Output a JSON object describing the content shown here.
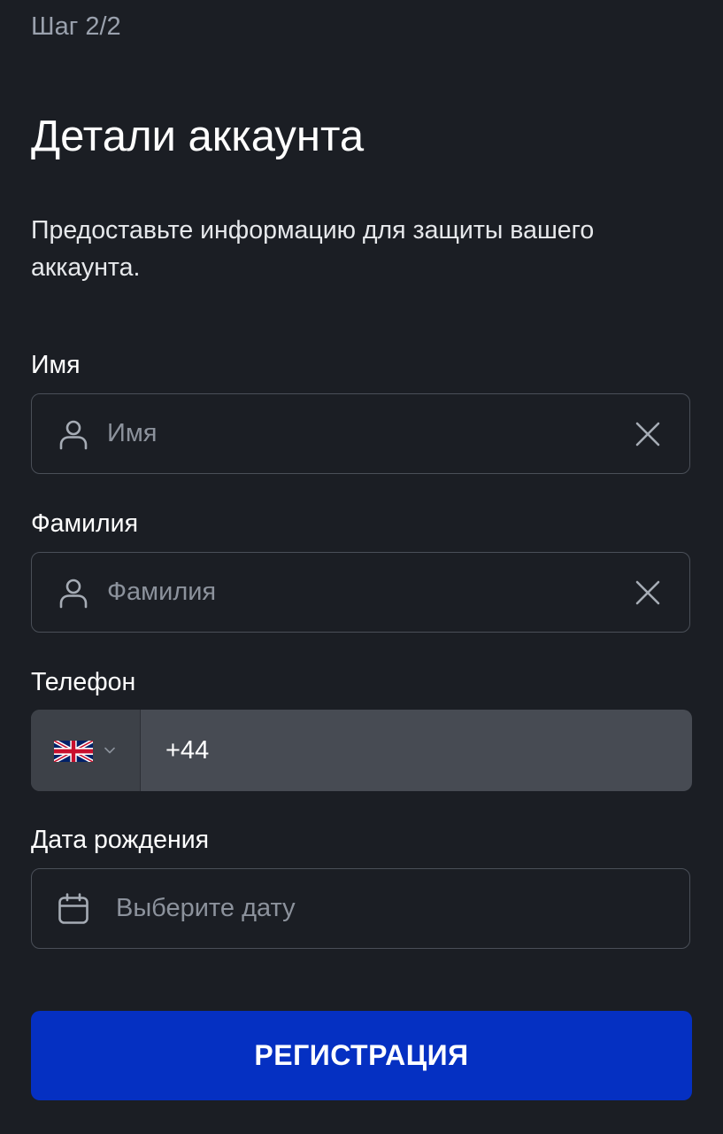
{
  "header": {
    "step": "Шаг 2/2",
    "title": "Детали аккаунта",
    "subtitle": "Предоставьте информацию для защиты вашего аккаунта."
  },
  "form": {
    "first_name": {
      "label": "Имя",
      "placeholder": "Имя",
      "value": "",
      "icon": "user-icon",
      "clear_icon": "close-icon"
    },
    "last_name": {
      "label": "Фамилия",
      "placeholder": "Фамилия",
      "value": "",
      "icon": "user-icon",
      "clear_icon": "close-icon"
    },
    "phone": {
      "label": "Телефон",
      "country_flag": "uk-flag-icon",
      "dropdown_icon": "chevron-down-icon",
      "value": "+44"
    },
    "birth_date": {
      "label": "Дата рождения",
      "placeholder": "Выберите дату",
      "value": "",
      "icon": "calendar-icon"
    }
  },
  "submit_button": {
    "label": "РЕГИСТРАЦИЯ"
  },
  "colors": {
    "background": "#1b1e24",
    "field_border": "#4a4f58",
    "phone_field_bg": "#474b53",
    "primary_button": "#0530c2",
    "muted_text": "#9aa1ad",
    "placeholder": "#8c929c"
  }
}
